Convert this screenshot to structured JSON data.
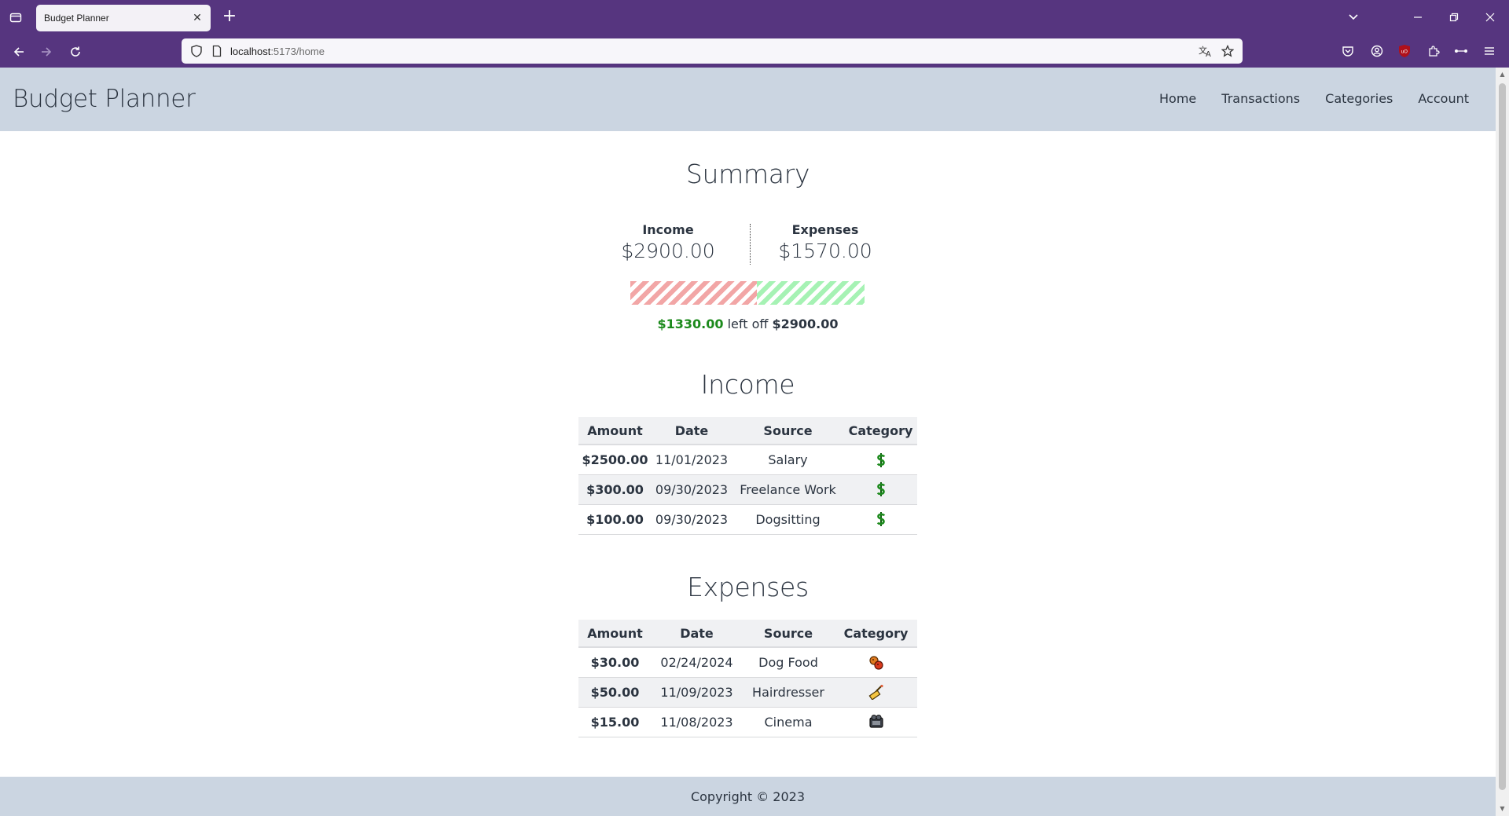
{
  "browser": {
    "tab_title": "Budget Planner",
    "url_host": "localhost",
    "url_path": ":5173/home",
    "accent": "#56357f"
  },
  "app": {
    "brand": "Budget Planner",
    "nav": [
      "Home",
      "Transactions",
      "Categories",
      "Account"
    ]
  },
  "summary": {
    "title": "Summary",
    "income_label": "Income",
    "income_value": "$2900.00",
    "expenses_label": "Expenses",
    "expenses_value": "$1570.00",
    "spent_fraction": 0.541,
    "left_amount": "$1330.00",
    "left_text": "left off",
    "total_amount": "$2900.00"
  },
  "income": {
    "title": "Income",
    "columns": [
      "Amount",
      "Date",
      "Source",
      "Category"
    ],
    "rows": [
      {
        "amount": "$2500.00",
        "date": "11/01/2023",
        "source": "Salary",
        "icon": "dollar-icon"
      },
      {
        "amount": "$300.00",
        "date": "09/30/2023",
        "source": "Freelance Work",
        "icon": "dollar-icon"
      },
      {
        "amount": "$100.00",
        "date": "09/30/2023",
        "source": "Dogsitting",
        "icon": "dollar-icon"
      }
    ]
  },
  "expenses": {
    "title": "Expenses",
    "columns": [
      "Amount",
      "Date",
      "Source",
      "Category"
    ],
    "rows": [
      {
        "amount": "$30.00",
        "date": "02/24/2024",
        "source": "Dog Food",
        "icon": "food-icon"
      },
      {
        "amount": "$50.00",
        "date": "11/09/2023",
        "source": "Hairdresser",
        "icon": "beauty-icon"
      },
      {
        "amount": "$15.00",
        "date": "11/08/2023",
        "source": "Cinema",
        "icon": "cinema-icon"
      }
    ]
  },
  "footer": {
    "text": "Copyright © 2023"
  },
  "colors": {
    "header_bg": "#cbd5e1",
    "income_green": "#1c8a1c",
    "expense_red": "#d90f0f"
  }
}
